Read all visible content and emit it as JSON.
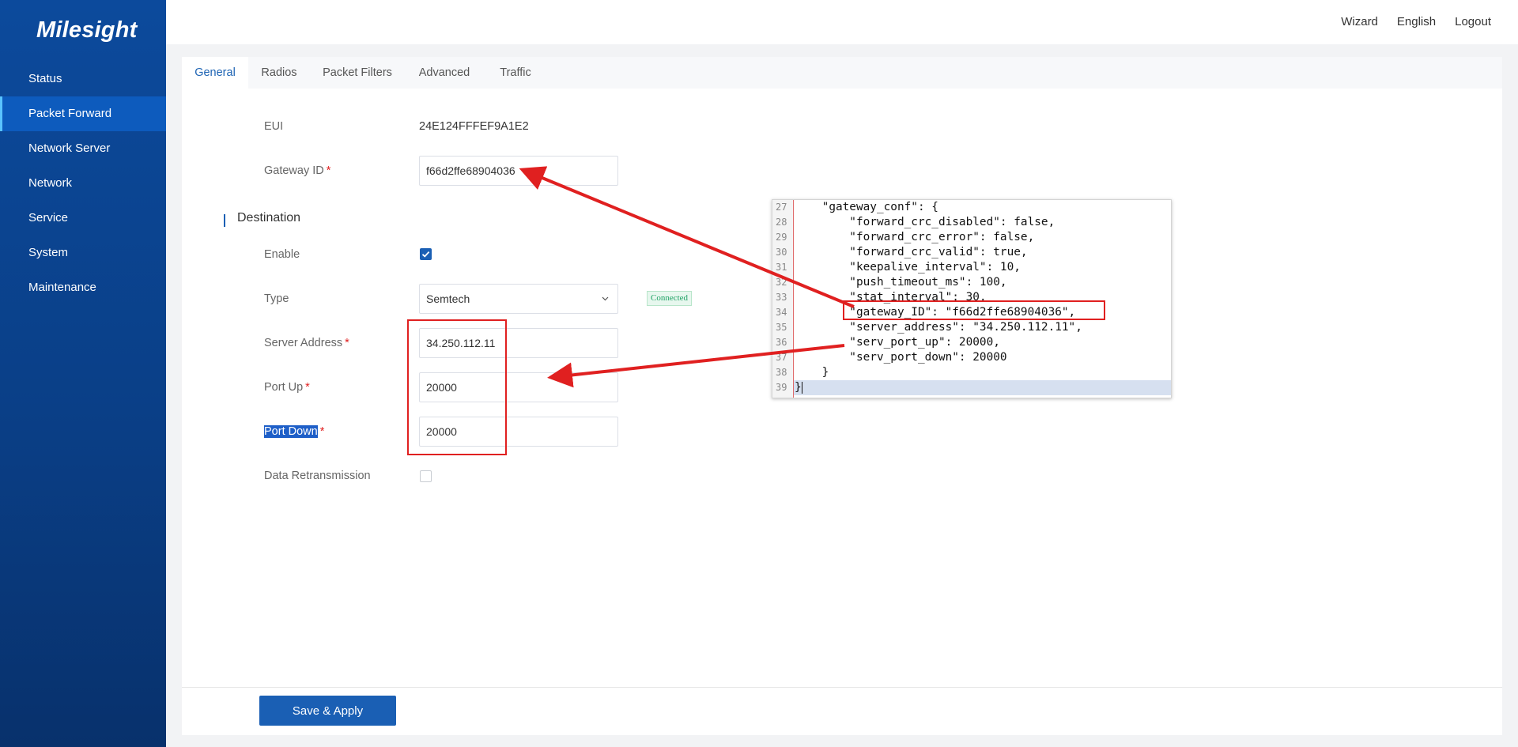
{
  "sidebar": {
    "logo": "Milesight",
    "items": [
      {
        "label": "Status"
      },
      {
        "label": "Packet Forward"
      },
      {
        "label": "Network Server"
      },
      {
        "label": "Network"
      },
      {
        "label": "Service"
      },
      {
        "label": "System"
      },
      {
        "label": "Maintenance"
      }
    ],
    "active": "Packet Forward"
  },
  "header": {
    "links": [
      "Wizard",
      "English",
      "Logout"
    ]
  },
  "tabs": [
    {
      "label": "General"
    },
    {
      "label": "Radios"
    },
    {
      "label": "Packet Filters"
    },
    {
      "label": "Advanced"
    },
    {
      "label": "Traffic"
    }
  ],
  "active_tab": "General",
  "form": {
    "eui_label": "EUI",
    "eui_value": "24E124FFFEF9A1E2",
    "gateway_id_label": "Gateway ID",
    "gateway_id_value": "f66d2ffe68904036",
    "required_mark": "*",
    "destination_title": "Destination",
    "enable_label": "Enable",
    "enable_checked": true,
    "type_label": "Type",
    "type_value": "Semtech",
    "status_badge": "Connected",
    "server_address_label": "Server Address",
    "server_address_value": "34.250.112.11",
    "port_up_label": "Port Up",
    "port_up_value": "20000",
    "port_down_label": "Port Down",
    "port_down_value": "20000",
    "data_retransmission_label": "Data Retransmission",
    "data_retransmission_checked": false
  },
  "footer": {
    "save_label": "Save & Apply"
  },
  "code_popup": {
    "lines": [
      {
        "num": "27",
        "text": "    \"gateway_conf\": {"
      },
      {
        "num": "28",
        "text": "        \"forward_crc_disabled\": false,"
      },
      {
        "num": "29",
        "text": "        \"forward_crc_error\": false,"
      },
      {
        "num": "30",
        "text": "        \"forward_crc_valid\": true,"
      },
      {
        "num": "31",
        "text": "        \"keepalive_interval\": 10,"
      },
      {
        "num": "32",
        "text": "        \"push_timeout_ms\": 100,"
      },
      {
        "num": "33",
        "text": "        \"stat_interval\": 30,"
      },
      {
        "num": "34",
        "text": "        \"gateway_ID\": \"f66d2ffe68904036\","
      },
      {
        "num": "35",
        "text": "        \"server_address\": \"34.250.112.11\","
      },
      {
        "num": "36",
        "text": "        \"serv_port_up\": 20000,"
      },
      {
        "num": "37",
        "text": "        \"serv_port_down\": 20000"
      },
      {
        "num": "38",
        "text": "    }"
      },
      {
        "num": "39",
        "text": "}"
      }
    ]
  },
  "colors": {
    "sidebar_bg": "#0c4a9c",
    "accent": "#1a5fb4",
    "annotation_red": "#e02020",
    "connected_green": "#21a366"
  }
}
